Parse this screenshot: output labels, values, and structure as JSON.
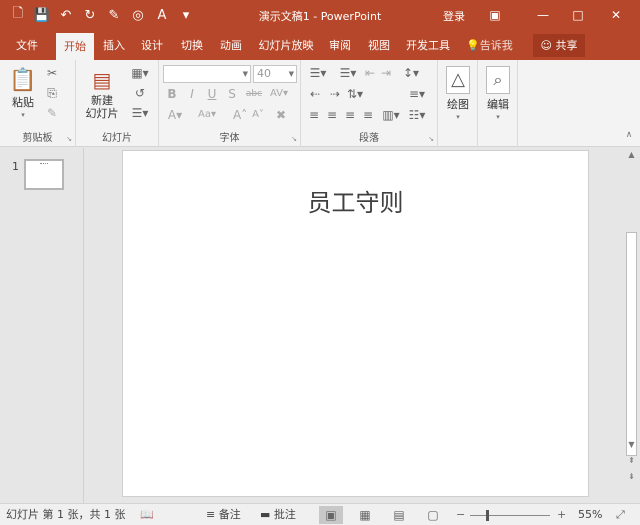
{
  "window": {
    "title": "演示文稿1 - PowerPoint",
    "login": "登录"
  },
  "tabs": [
    "文件",
    "开始",
    "插入",
    "设计",
    "切换",
    "动画",
    "幻灯片放映",
    "审阅",
    "视图",
    "开发工具"
  ],
  "active_tab": "开始",
  "tell_me": "告诉我",
  "share": "共享",
  "ribbon": {
    "clipboard": {
      "paste": "粘贴",
      "label": "剪贴板"
    },
    "slides": {
      "new_slide_line1": "新建",
      "new_slide_line2": "幻灯片",
      "label": "幻灯片"
    },
    "font": {
      "font_name": "",
      "font_size": "40",
      "label": "字体"
    },
    "paragraph": {
      "label": "段落"
    },
    "drawing": {
      "label": "绘图"
    },
    "editing": {
      "label": "编辑"
    }
  },
  "thumbnails": [
    {
      "number": "1"
    }
  ],
  "slide": {
    "title": "员工守则"
  },
  "status": {
    "slide_info": "幻灯片 第 1 张，共 1 张",
    "notes": "备注",
    "comments": "批注",
    "zoom": "55%"
  },
  "colors": {
    "accent": "#b7472a",
    "ribbon_bg": "#f3f3f3",
    "workspace_bg": "#e6e6e6"
  }
}
